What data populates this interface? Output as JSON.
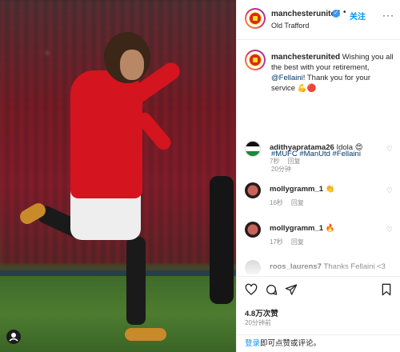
{
  "post": {
    "image_alt": "",
    "tag_icon": "user-tag-icon"
  },
  "header": {
    "username": "manchesterunited",
    "verified_icon": "verified-badge-icon",
    "separator": "•",
    "follow_label": "关注",
    "location": "Old Trafford",
    "more_icon": "more-options-icon"
  },
  "caption": {
    "username": "manchesterunited",
    "text_before": "Wishing you all the best with your retirement, ",
    "mention": "@Fellaini",
    "text_after": "! Thank you for your service ",
    "emojis": [
      "💪",
      "🔴"
    ],
    "hashtags": "#MUFC #ManUtd #Fellaini",
    "time": "20分钟"
  },
  "comments": [
    {
      "username": "adithyapratama26",
      "text": "Idola",
      "emoji": "😍",
      "time": "7秒",
      "reply": "回复"
    },
    {
      "username": "mollygramm_1",
      "text": "",
      "emoji": "👏",
      "time": "16秒",
      "reply": "回复"
    },
    {
      "username": "mollygramm_1",
      "text": "",
      "emoji": "🔥",
      "time": "17秒",
      "reply": "回复"
    },
    {
      "username": "roos_laurens7",
      "text": "Thanks Fellaini <3",
      "emoji": "",
      "time": "",
      "reply": ""
    }
  ],
  "actions": {
    "like_icon": "heart-icon",
    "comment_icon": "comment-icon",
    "share_icon": "share-icon",
    "save_icon": "bookmark-icon"
  },
  "likes": "4.8万次赞",
  "post_time": "20分钟前",
  "login": {
    "link": "登录",
    "rest": "即可点赞或评论。"
  },
  "colors": {
    "link_blue": "#0095f6",
    "hashtag_blue": "#00376b",
    "united_red": "#da291c",
    "verified_blue": "#3897f0"
  }
}
